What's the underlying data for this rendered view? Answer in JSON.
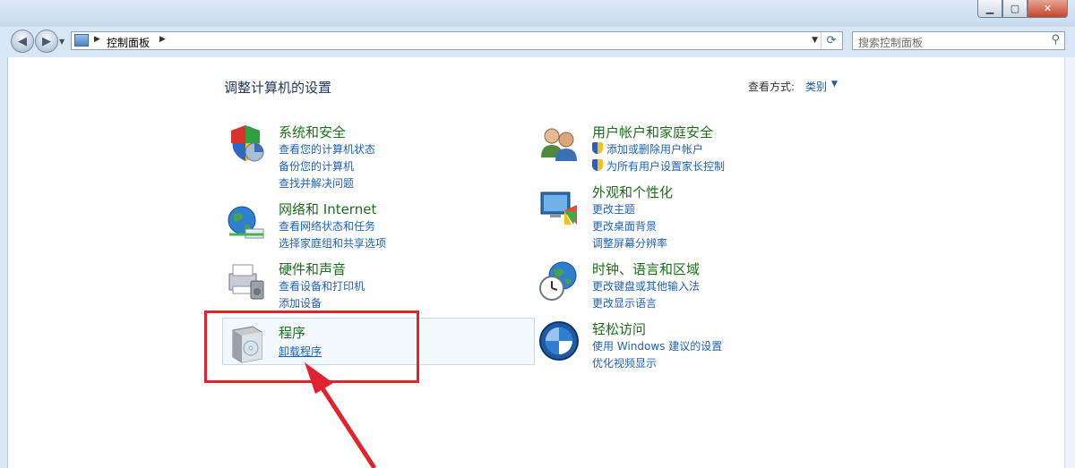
{
  "window": {
    "min_label": "▁",
    "max_label": "▢",
    "close_label": "✕"
  },
  "nav": {
    "back_glyph": "◀",
    "forward_glyph": "▶",
    "address_path": "控制面板",
    "search_placeholder": "搜索控制面板",
    "refresh_glyph": "⟳",
    "search_glyph": "⚲"
  },
  "page": {
    "heading": "调整计算机的设置",
    "view_by_label": "查看方式:",
    "view_by_value": "类别"
  },
  "categories": [
    {
      "title": "系统和安全",
      "links": [
        "查看您的计算机状态",
        "备份您的计算机",
        "查找并解决问题"
      ]
    },
    {
      "title": "网络和 Internet",
      "links": [
        "查看网络状态和任务",
        "选择家庭组和共享选项"
      ]
    },
    {
      "title": "硬件和声音",
      "links": [
        "查看设备和打印机",
        "添加设备"
      ]
    },
    {
      "title": "程序",
      "links": [
        "卸载程序"
      ]
    },
    {
      "title": "用户帐户和家庭安全",
      "links": [
        "添加或删除用户帐户",
        "为所有用户设置家长控制"
      ]
    },
    {
      "title": "外观和个性化",
      "links": [
        "更改主题",
        "更改桌面背景",
        "调整屏幕分辨率"
      ]
    },
    {
      "title": "时钟、语言和区域",
      "links": [
        "更改键盘或其他输入法",
        "更改显示语言"
      ]
    },
    {
      "title": "轻松访问",
      "links": [
        "使用 Windows 建议的设置",
        "优化视频显示"
      ]
    }
  ],
  "colors": {
    "title_green": "#1c6e1c",
    "link_blue": "#1f62b7",
    "annotation_red": "#e0232e"
  }
}
